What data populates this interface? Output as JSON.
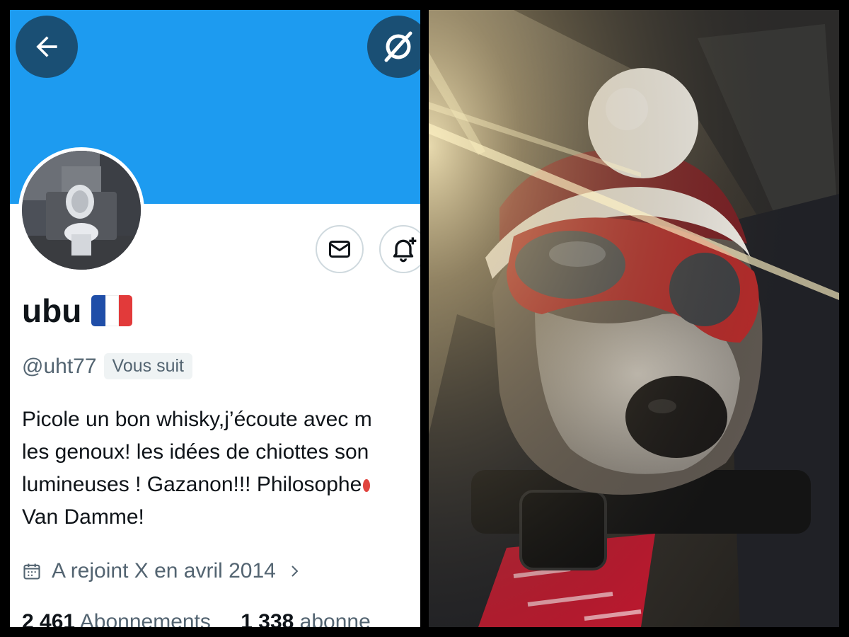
{
  "profile": {
    "display_name": "ubu",
    "flag_emoji": "🇫🇷",
    "flag_colors": [
      "#1f4ea8",
      "#ffffff",
      "#e23a3a"
    ],
    "handle": "@uht77",
    "follows_you_badge": "Vous suit",
    "bio_lines": [
      "Picole un bon whisky,j’écoute avec m",
      "les genoux! les idées de chiottes son",
      "lumineuses ! Gazanon!!! Philosophe",
      "Van Damme!"
    ],
    "joined": "A rejoint X en avril 2014",
    "following_count": "2 461",
    "following_label": "Abonnements",
    "followers_count": "1 338",
    "followers_label": "abonne"
  },
  "icons": {
    "back": "arrow-left-icon",
    "share": "share-icon",
    "mail": "mail-icon",
    "notify": "bell-plus-icon",
    "calendar": "calendar-icon",
    "chevron": "chevron-right-icon"
  },
  "colors": {
    "banner": "#1d9bf0",
    "text_primary": "#0f1419",
    "text_secondary": "#536471",
    "button_dark": "#1a4f74"
  }
}
